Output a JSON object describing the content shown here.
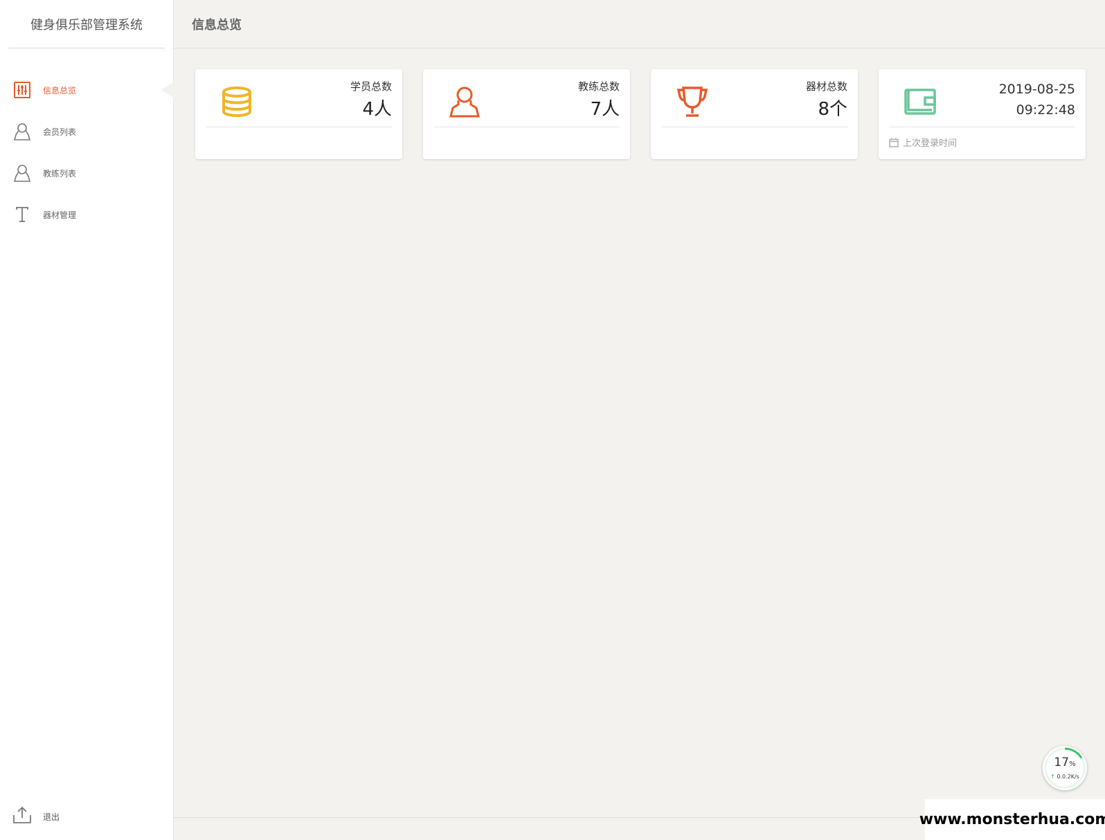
{
  "sidebar": {
    "brand": "健身俱乐部管理系统",
    "items": [
      {
        "label": "信息总览",
        "icon": "sliders-icon",
        "active": true
      },
      {
        "label": "会员列表",
        "icon": "user-icon",
        "active": false
      },
      {
        "label": "教练列表",
        "icon": "user-icon",
        "active": false
      },
      {
        "label": "器材管理",
        "icon": "text-t-icon",
        "active": false
      }
    ],
    "logout": {
      "label": "退出",
      "icon": "upload-icon"
    }
  },
  "header": {
    "title": "信息总览"
  },
  "cards": [
    {
      "caption": "学员总数",
      "value": "4人",
      "icon": "database-icon",
      "color": "#f0b429"
    },
    {
      "caption": "教练总数",
      "value": "7人",
      "icon": "user-icon",
      "color": "#e65a2b"
    },
    {
      "caption": "器材总数",
      "value": "8个",
      "icon": "trophy-icon",
      "color": "#e65a2b"
    },
    {
      "date": "2019-08-25",
      "time": "09:22:48",
      "footer": "上次登录时间",
      "icon": "wallet-icon",
      "color": "#6cc49a"
    }
  ],
  "speed_widget": {
    "percent": "17",
    "percent_unit": "%",
    "rate": "0.0.2K/s"
  },
  "watermark": "www.monsterhua.com",
  "colors": {
    "accent": "#e65a2b",
    "gold": "#f0b429",
    "green": "#6cc49a"
  }
}
